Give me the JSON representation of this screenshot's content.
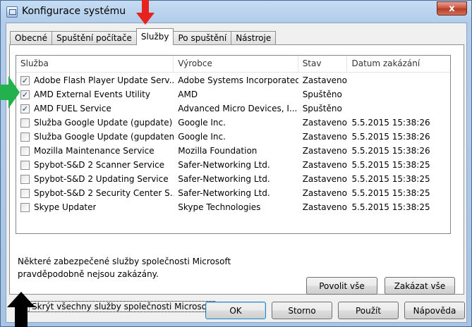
{
  "window": {
    "title": "Konfigurace systému",
    "close_label": "x"
  },
  "tabs": [
    {
      "label": "Obecné",
      "active": false
    },
    {
      "label": "Spuštění počítače",
      "active": false
    },
    {
      "label": "Služby",
      "active": true
    },
    {
      "label": "Po spuštění",
      "active": false
    },
    {
      "label": "Nástroje",
      "active": false
    }
  ],
  "list": {
    "headers": [
      "Služba",
      "Výrobce",
      "Stav",
      "Datum zakázání"
    ],
    "rows": [
      {
        "checked": true,
        "service": "Adobe Flash Player Update Serv...",
        "vendor": "Adobe Systems Incorporated",
        "status": "Zastaveno",
        "date": ""
      },
      {
        "checked": true,
        "service": "AMD External Events Utility",
        "vendor": "AMD",
        "status": "Spuštěno",
        "date": ""
      },
      {
        "checked": true,
        "service": "AMD FUEL Service",
        "vendor": "Advanced Micro Devices, I...",
        "status": "Spuštěno",
        "date": ""
      },
      {
        "checked": false,
        "service": "Služba Google Update (gupdate)",
        "vendor": "Google Inc.",
        "status": "Zastaveno",
        "date": "5.5.2015 15:38:26"
      },
      {
        "checked": false,
        "service": "Služba Google Update (gupdatem)",
        "vendor": "Google Inc.",
        "status": "Zastaveno",
        "date": "5.5.2015 15:38:26"
      },
      {
        "checked": false,
        "service": "Mozilla Maintenance Service",
        "vendor": "Mozilla Foundation",
        "status": "Zastaveno",
        "date": "5.5.2015 15:38:26"
      },
      {
        "checked": false,
        "service": "Spybot-S&D 2 Scanner Service",
        "vendor": "Safer-Networking Ltd.",
        "status": "Zastaveno",
        "date": "5.5.2015 15:38:25"
      },
      {
        "checked": false,
        "service": "Spybot-S&D 2 Updating Service",
        "vendor": "Safer-Networking Ltd.",
        "status": "Zastaveno",
        "date": "5.5.2015 15:38:25"
      },
      {
        "checked": false,
        "service": "Spybot-S&D 2 Security Center S...",
        "vendor": "Safer-Networking Ltd.",
        "status": "Zastaveno",
        "date": "5.5.2015 15:38:25"
      },
      {
        "checked": false,
        "service": "Skype Updater",
        "vendor": "Skype Technologies",
        "status": "Zastaveno",
        "date": "5.5.2015 15:38:25"
      }
    ]
  },
  "note": "Některé zabezpečené služby společnosti Microsoft pravděpodobně nejsou zakázány.",
  "buttons": {
    "enable_all": "Povolit vše",
    "disable_all": "Zakázat vše",
    "ok": "OK",
    "cancel": "Storno",
    "apply": "Použít",
    "help": "Nápověda"
  },
  "hide_ms": {
    "checked": true,
    "label": "Skrýt všechny služby společnosti Microsoft"
  },
  "colors": {
    "arrow_red": "#e8231f",
    "arrow_green": "#22b14c",
    "arrow_black": "#000000"
  },
  "check_glyph": "✓"
}
